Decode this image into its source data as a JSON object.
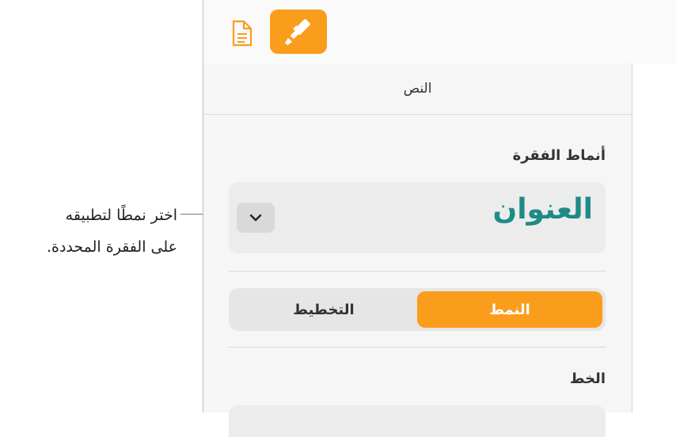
{
  "callout": {
    "line1": "اختر نمطًا لتطبيقه",
    "line2": "على الفقرة المحددة."
  },
  "toolbar": {
    "document_icon": "document-icon",
    "format_icon": "paintbrush-icon",
    "accent_color": "#fb9d1c"
  },
  "sidebar": {
    "tab_label": "النص",
    "paragraph_styles_heading": "أنماط الفقرة",
    "current_style": "العنوان",
    "style_color": "#1e8b86",
    "segments": {
      "style": "النمط",
      "layout": "التخطيط",
      "selected": "النمط"
    },
    "font_heading": "الخط"
  }
}
